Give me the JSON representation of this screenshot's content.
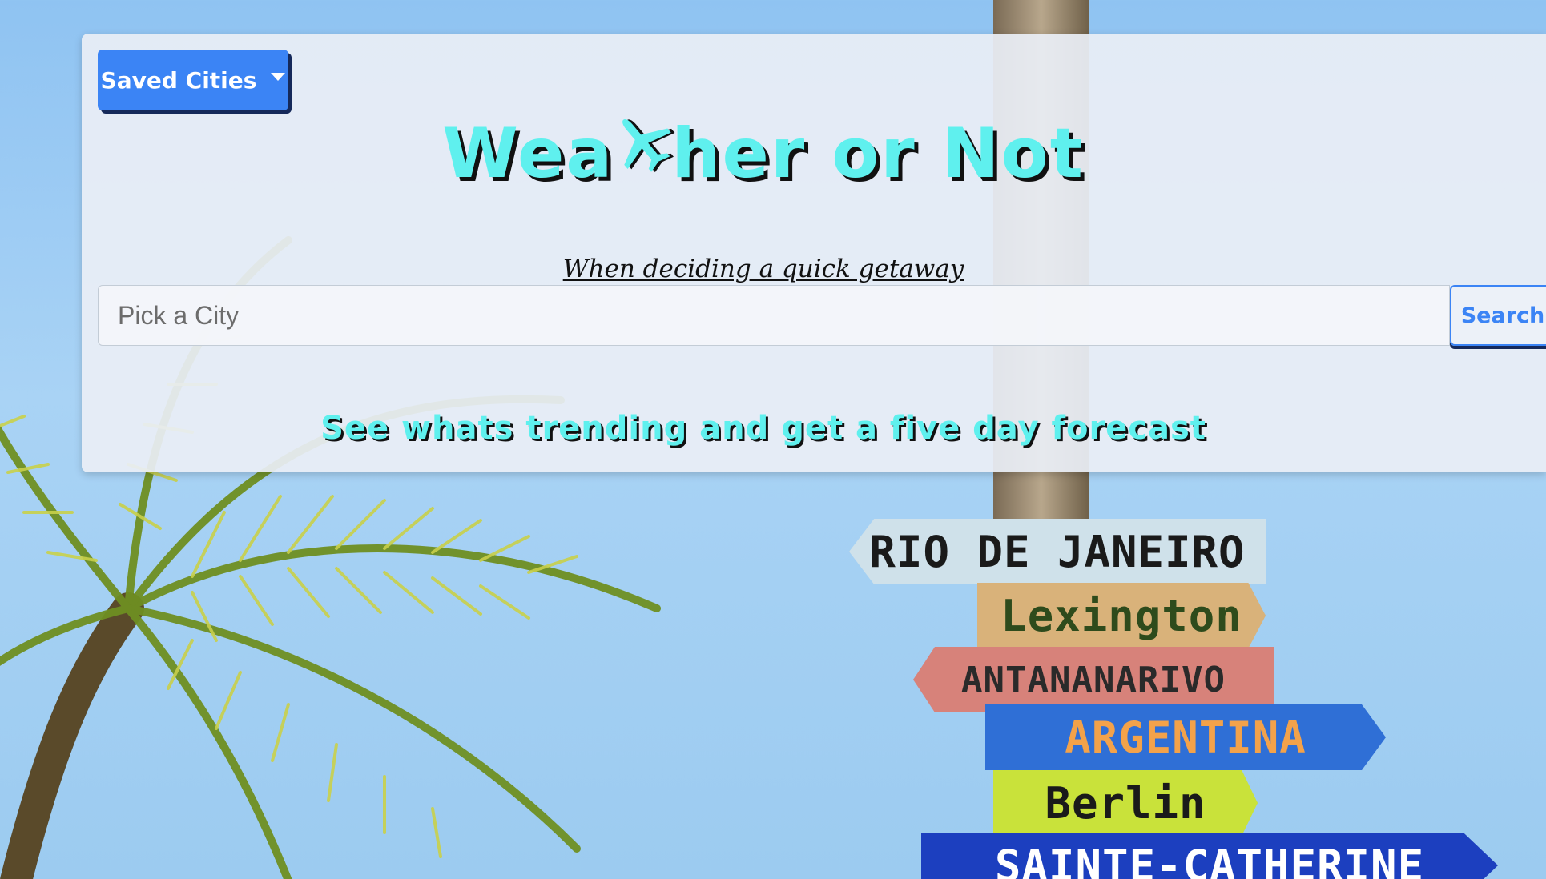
{
  "header": {
    "saved_cities_label": "Saved Cities",
    "title_before_icon": "Wea",
    "title_icon": "airplane-icon",
    "title_after_icon": "her or Not",
    "subtitle": "When deciding a quick getaway"
  },
  "search": {
    "placeholder": "Pick a City",
    "value": "",
    "button_label": "Search"
  },
  "tagline": "See whats trending and get a five day forecast",
  "colors": {
    "accent_blue": "#3b84f5",
    "title_cyan": "#5ff0ee",
    "shadow_dark": "#111111",
    "panel_bg": "#e9eef5"
  },
  "background": {
    "signs": [
      "RIO DE JANEIRO",
      "Lexington",
      "ANTANANARIVO",
      "ARGENTINA",
      "Berlin",
      "SAINTE-CATHERINE"
    ]
  }
}
